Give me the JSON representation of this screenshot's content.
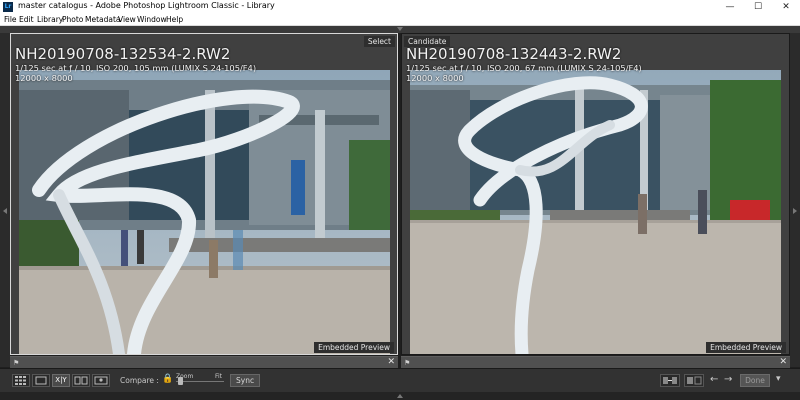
{
  "window": {
    "title": "master catalogus - Adobe Photoshop Lightroom Classic - Library",
    "app_icon_text": "Lr",
    "minimize_glyph": "—",
    "maximize_glyph": "☐",
    "close_glyph": "✕"
  },
  "menu": {
    "items": [
      "File",
      "Edit",
      "Library",
      "Photo",
      "Metadata",
      "View",
      "Window",
      "Help"
    ]
  },
  "compare": {
    "select": {
      "tag": "Select",
      "filename": "NH20190708-132534-2.RW2",
      "exif": "1/125 sec at ƒ / 10, ISO 200, 105 mm (LUMIX S 24-105/F4)",
      "dimensions": "12000 x 8000",
      "preview_label": "Embedded Preview"
    },
    "candidate": {
      "tag": "Candidate",
      "filename": "NH20190708-132443-2.RW2",
      "exif": "1/125 sec at ƒ / 10, ISO 200, 67 mm (LUMIX S 24-105/F4)",
      "dimensions": "12000 x 8000",
      "preview_label": "Embedded Preview"
    }
  },
  "toolbar": {
    "compare_label": "Compare :",
    "zoom_label": "Zoom",
    "fit_label": "Fit",
    "sync_label": "Sync",
    "done_label": "Done",
    "xy_label": "X|Y",
    "prev_glyph": "←",
    "next_glyph": "→"
  },
  "colors": {
    "panel_bg": "#404040",
    "toolbar_bg": "#323232",
    "accent_select_border": "#d9d9d9"
  }
}
